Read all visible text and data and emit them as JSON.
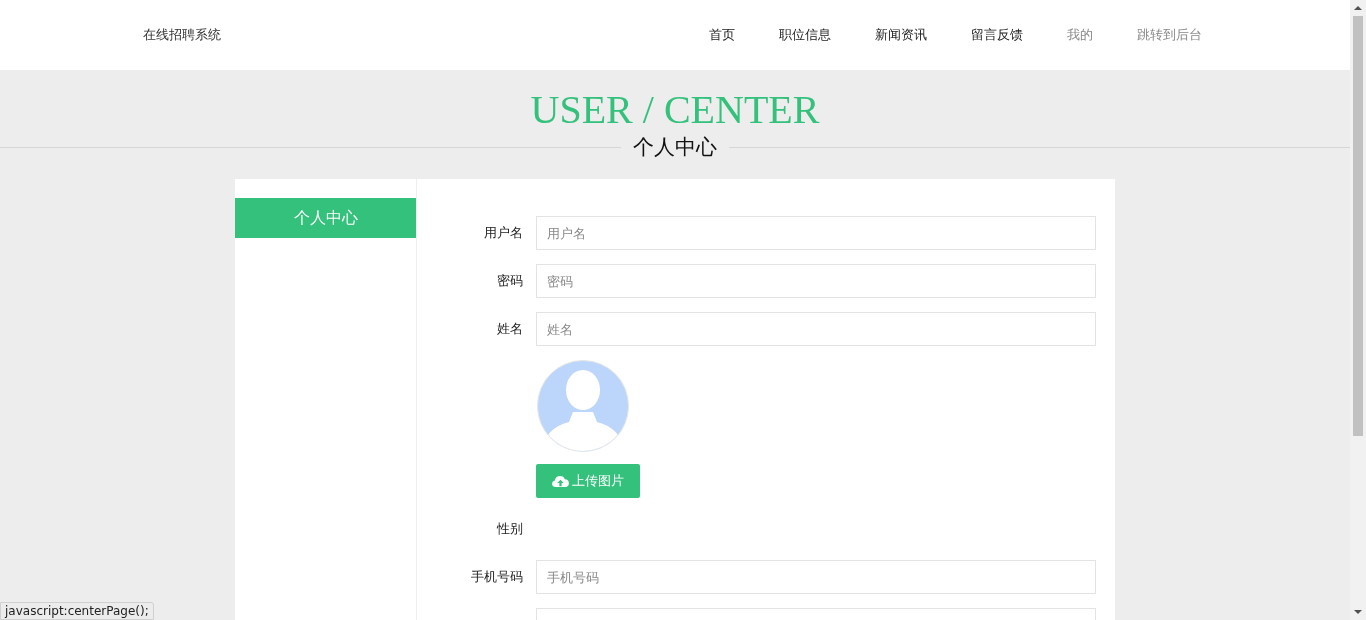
{
  "header": {
    "brand": "在线招聘系统",
    "nav": [
      {
        "label": "首页",
        "kind": "primary"
      },
      {
        "label": "职位信息",
        "kind": "primary"
      },
      {
        "label": "新闻资讯",
        "kind": "primary"
      },
      {
        "label": "留言反馈",
        "kind": "primary"
      },
      {
        "label": "我的",
        "kind": "secondary"
      },
      {
        "label": "跳转到后台",
        "kind": "secondary"
      }
    ]
  },
  "banner": {
    "title": "USER / CENTER",
    "subtitle": "个人中心"
  },
  "sidebar": {
    "items": [
      {
        "label": "个人中心",
        "selected": true
      }
    ]
  },
  "form": {
    "fields": [
      {
        "kind": "text",
        "label": "用户名",
        "placeholder": "用户名"
      },
      {
        "kind": "text",
        "label": "密码",
        "placeholder": "密码"
      },
      {
        "kind": "text",
        "label": "姓名",
        "placeholder": "姓名"
      },
      {
        "kind": "avatar"
      },
      {
        "kind": "upload",
        "button": "上传图片"
      },
      {
        "kind": "choice",
        "label": "性别"
      },
      {
        "kind": "text",
        "label": "手机号码",
        "placeholder": "手机号码"
      },
      {
        "kind": "text"
      }
    ]
  },
  "status_bar": {
    "text": "javascript:centerPage();"
  }
}
